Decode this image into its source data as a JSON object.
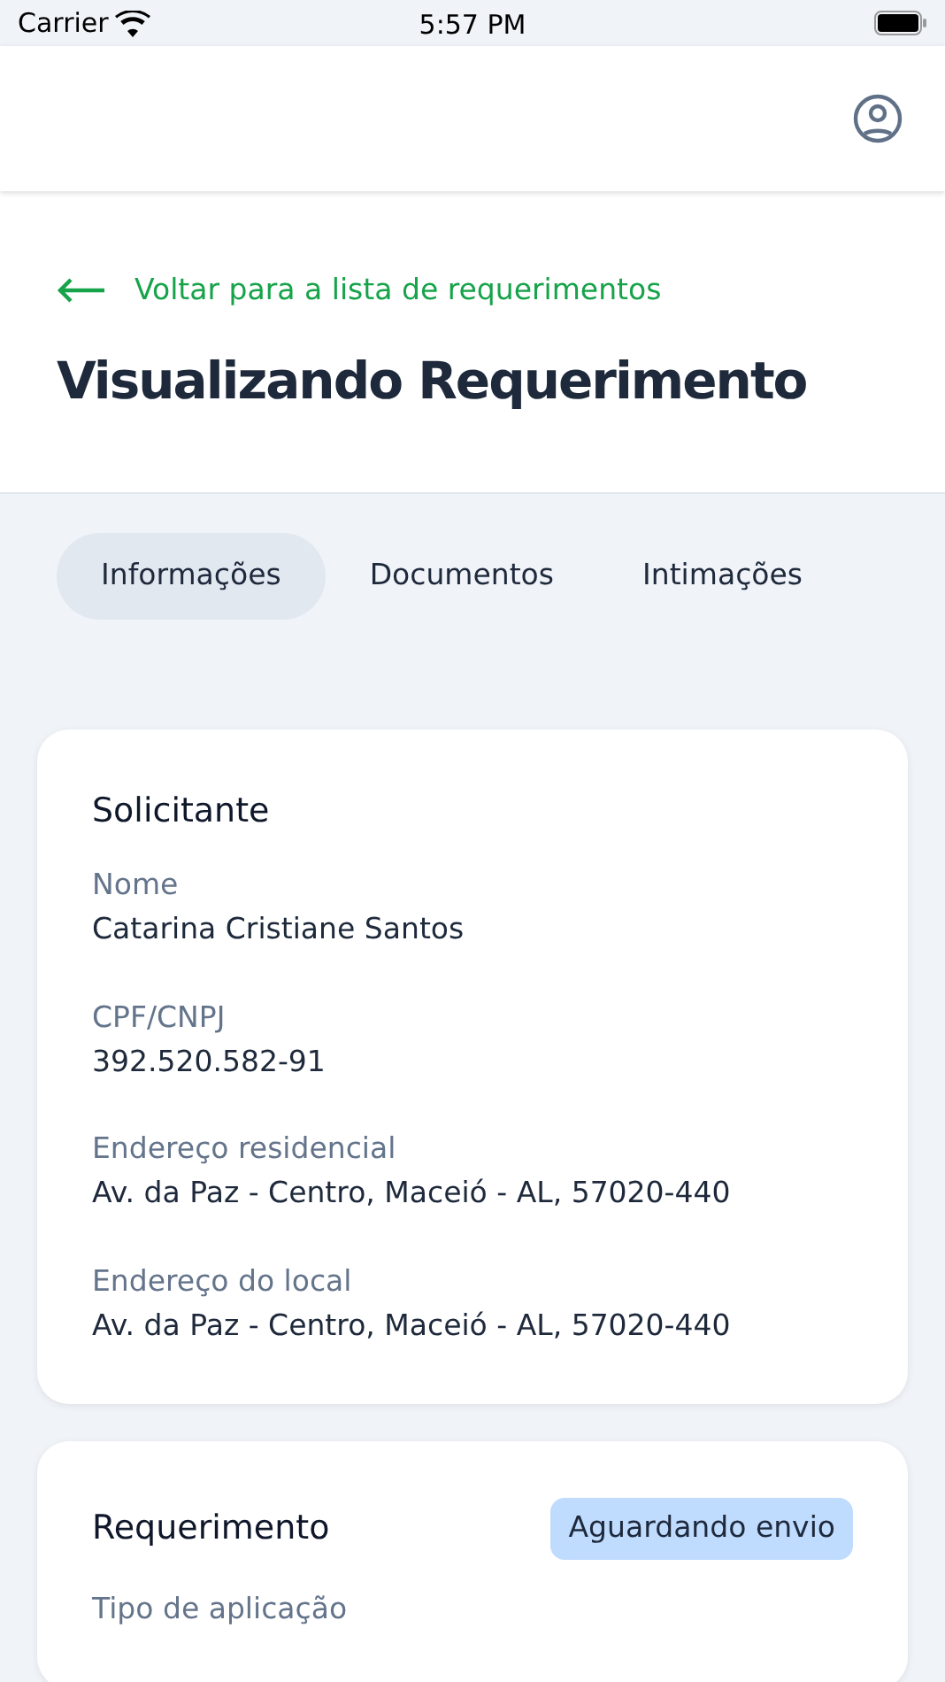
{
  "status_bar": {
    "carrier": "Carrier",
    "time": "5:57 PM"
  },
  "back_link": {
    "label": "Voltar para a lista de requerimentos"
  },
  "title": "Visualizando Requerimento",
  "tabs": [
    {
      "label": "Informações",
      "selected": true
    },
    {
      "label": "Documentos",
      "selected": false
    },
    {
      "label": "Intimações",
      "selected": false
    }
  ],
  "cards": [
    {
      "title": "Solicitante",
      "fields": [
        {
          "label": "Nome",
          "value": "Catarina Cristiane Santos"
        },
        {
          "label": "CPF/CNPJ",
          "value": "392.520.582-91"
        },
        {
          "label": "Endereço residencial",
          "value": "Av. da Paz - Centro, Maceió - AL, 57020-440"
        },
        {
          "label": "Endereço do local",
          "value": "Av. da Paz - Centro, Maceió - AL, 57020-440"
        }
      ]
    },
    {
      "title": "Requerimento",
      "status": "Aguardando envio",
      "fields": [
        {
          "label": "Tipo de aplicação"
        }
      ]
    }
  ]
}
